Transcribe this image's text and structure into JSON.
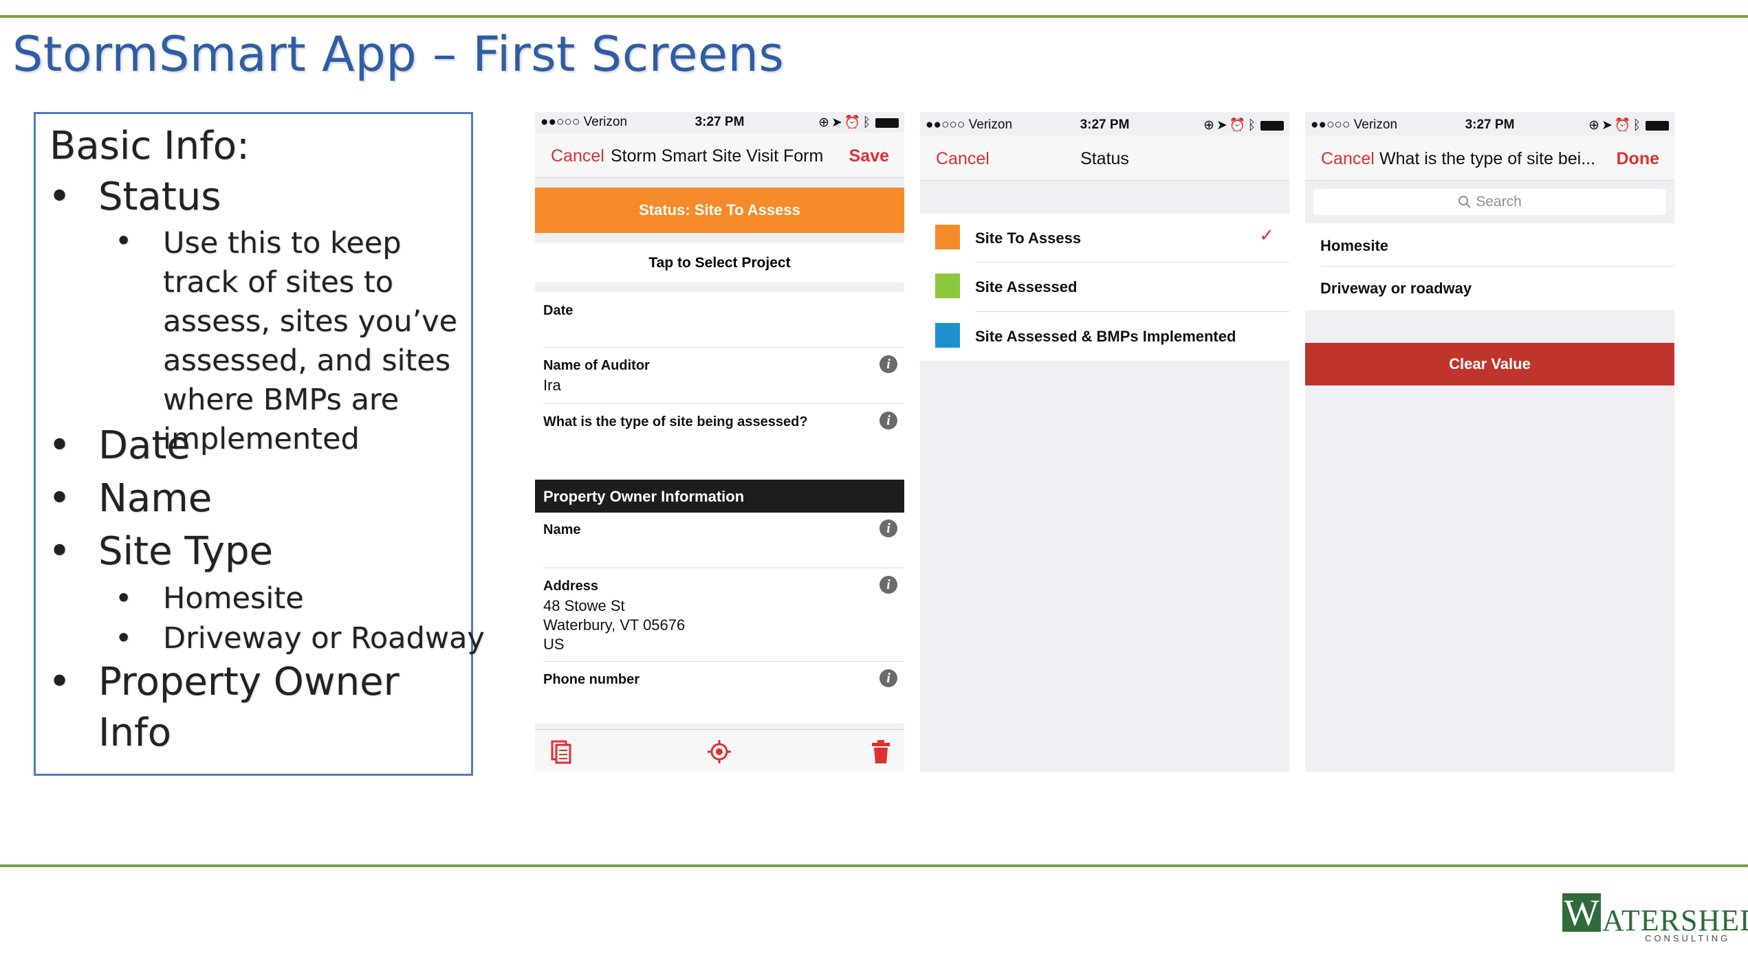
{
  "slide": {
    "title": "StormSmart App – First Screens"
  },
  "info_box": {
    "heading": "Basic Info:",
    "bullets": [
      "Status",
      "Use this to keep track of sites to assess, sites you’ve assessed, and sites where BMPs are implemented",
      "Date",
      "Name",
      "Site Type",
      "Homesite",
      "Driveway or Roadway",
      "Property Owner",
      "Info"
    ],
    "bullet_glyph": "•"
  },
  "statusbar": {
    "carrier": "●●○○○ Verizon",
    "time": "3:27 PM"
  },
  "screen1": {
    "nav": {
      "cancel": "Cancel",
      "title": "Storm Smart Site Visit Form",
      "save": "Save"
    },
    "status_button": "Status: Site To Assess",
    "project": "Tap to Select Project",
    "fields": [
      {
        "label": "Date",
        "value": ""
      },
      {
        "label": "Name of Auditor",
        "value": "Ira"
      },
      {
        "label": "What is the type of site being assessed?",
        "value": ""
      }
    ],
    "section": "Property Owner Information",
    "owner_fields": [
      {
        "label": "Name",
        "value": ""
      },
      {
        "label": "Address",
        "value": "48 Stowe St\nWaterbury, VT 05676\nUS"
      },
      {
        "label": "Phone number",
        "value": ""
      }
    ],
    "info_glyph": "i",
    "toolbar": [
      "copy-icon",
      "locate-icon",
      "trash-icon"
    ]
  },
  "screen2": {
    "nav": {
      "cancel": "Cancel",
      "title": "Status"
    },
    "options": [
      {
        "label": "Site To Assess",
        "color": "#f58b28",
        "checked": true
      },
      {
        "label": "Site Assessed",
        "color": "#8dc63f",
        "checked": false
      },
      {
        "label": "Site Assessed & BMPs Implemented",
        "color": "#1e90d0",
        "checked": false
      }
    ],
    "check_glyph": "✓"
  },
  "screen3": {
    "nav": {
      "cancel": "Cancel",
      "title": "What is the type of site bei...",
      "done": "Done"
    },
    "search_placeholder": "Search",
    "options": [
      "Homesite",
      "Driveway or roadway"
    ],
    "clear_button": "Clear Value"
  },
  "logo": {
    "initial": "W",
    "text": "ATERSHED",
    "sub": "CONSULTING"
  },
  "colors": {
    "accent_green": "#77a043",
    "title_blue": "#2f5da5",
    "ios_red": "#e02f2f",
    "status_orange": "#f58b28",
    "clear_red": "#c0352b"
  }
}
